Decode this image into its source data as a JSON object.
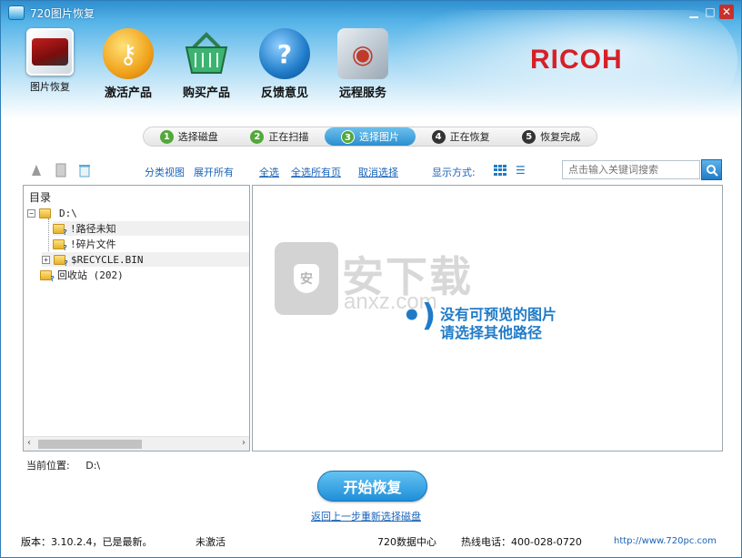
{
  "window": {
    "title": "720图片恢复",
    "controls": {
      "minimize": "▁",
      "maximize": "□",
      "close": "✕"
    }
  },
  "nav": [
    {
      "label": "图片恢复",
      "icon": "photo-stack-icon"
    },
    {
      "label": "激活产品",
      "icon": "key-icon"
    },
    {
      "label": "购买产品",
      "icon": "basket-icon"
    },
    {
      "label": "反馈意见",
      "icon": "help-icon"
    },
    {
      "label": "远程服务",
      "icon": "remote-service-icon"
    }
  ],
  "brand": "RICOH",
  "steps": [
    {
      "num": "1",
      "label": "选择磁盘",
      "state": "done"
    },
    {
      "num": "2",
      "label": "正在扫描",
      "state": "done"
    },
    {
      "num": "3",
      "label": "选择图片",
      "state": "active"
    },
    {
      "num": "4",
      "label": "正在恢复",
      "state": "pending"
    },
    {
      "num": "5",
      "label": "恢复完成",
      "state": "pending"
    }
  ],
  "toolbar": {
    "category_view": "分类视图",
    "expand_all": "展开所有",
    "select_all": "全选",
    "select_all_pages": "全选所有页",
    "cancel_selection": "取消选择",
    "display_mode": "显示方式:",
    "search_placeholder": "点击输入关键词搜索"
  },
  "tree": {
    "title": "目录",
    "root": "D:\\",
    "children": [
      "!路径未知",
      "!碎片文件",
      "$RECYCLE.BIN"
    ],
    "recycle": "回收站 (202)"
  },
  "preview": {
    "watermark": "安下载",
    "watermark_sub": "anxz.com",
    "empty_icon": "•)",
    "empty_line1": "没有可预览的图片",
    "empty_line2": "请选择其他路径"
  },
  "location": {
    "label": "当前位置:",
    "value": "D:\\"
  },
  "actions": {
    "start": "开始恢复",
    "back": "返回上一步重新选择磁盘"
  },
  "status": {
    "version": "版本：3.10.2.4，已是最新。",
    "activation": "未激活",
    "center": "720数据中心",
    "hotline": "热线电话：400-028-0720",
    "website": "http://www.720pc.com"
  },
  "colors": {
    "accent": "#1f7bc8",
    "brand": "#d81f26",
    "step_done": "#52a83a"
  }
}
